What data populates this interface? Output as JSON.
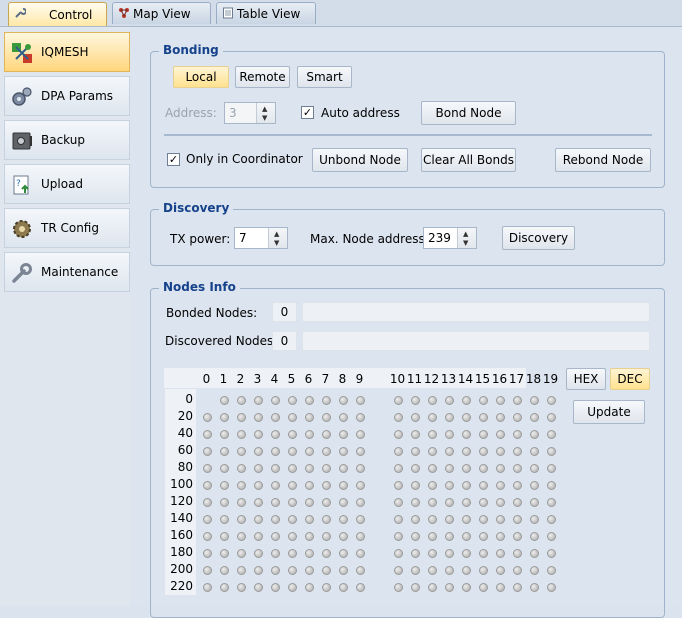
{
  "tabs": [
    {
      "label": "Control",
      "icon": "wrench-icon",
      "active": true
    },
    {
      "label": "Map View",
      "icon": "network-icon",
      "active": false
    },
    {
      "label": "Table View",
      "icon": "table-icon",
      "active": false
    }
  ],
  "sidebar": {
    "items": [
      {
        "label": "IQMESH",
        "icon": "mesh-network-icon",
        "active": true
      },
      {
        "label": "DPA Params",
        "icon": "gears-icon",
        "active": false
      },
      {
        "label": "Backup",
        "icon": "safe-icon",
        "active": false
      },
      {
        "label": "Upload",
        "icon": "upload-document-icon",
        "active": false
      },
      {
        "label": "TR Config",
        "icon": "config-gear-icon",
        "active": false
      },
      {
        "label": "Maintenance",
        "icon": "wrench-icon",
        "active": false
      }
    ]
  },
  "bonding": {
    "title": "Bonding",
    "modes": [
      "Local",
      "Remote",
      "Smart"
    ],
    "selected_mode": "Local",
    "address_label": "Address:",
    "address_value": "3",
    "auto_address_label": "Auto address",
    "auto_address_checked": true,
    "bond_node": "Bond Node",
    "only_coordinator_label": "Only in Coordinator",
    "only_coordinator_checked": true,
    "unbond_node": "Unbond Node",
    "clear_all_bonds": "Clear All Bonds",
    "rebond_node": "Rebond Node"
  },
  "discovery": {
    "title": "Discovery",
    "tx_power_label": "TX power:",
    "tx_power_value": "7",
    "max_node_label": "Max. Node address:",
    "max_node_value": "239",
    "discovery_button": "Discovery"
  },
  "nodes_info": {
    "title": "Nodes Info",
    "bonded_label": "Bonded Nodes:",
    "bonded_count": "0",
    "discovered_label": "Discovered Nodes:",
    "discovered_count": "0",
    "columns": [
      "0",
      "1",
      "2",
      "3",
      "4",
      "5",
      "6",
      "7",
      "8",
      "9",
      "10",
      "11",
      "12",
      "13",
      "14",
      "15",
      "16",
      "17",
      "18",
      "19"
    ],
    "rows": [
      "0",
      "20",
      "40",
      "60",
      "80",
      "100",
      "120",
      "140",
      "160",
      "180",
      "200",
      "220"
    ],
    "hex": "HEX",
    "dec": "DEC",
    "selected_format": "DEC",
    "update": "Update"
  }
}
